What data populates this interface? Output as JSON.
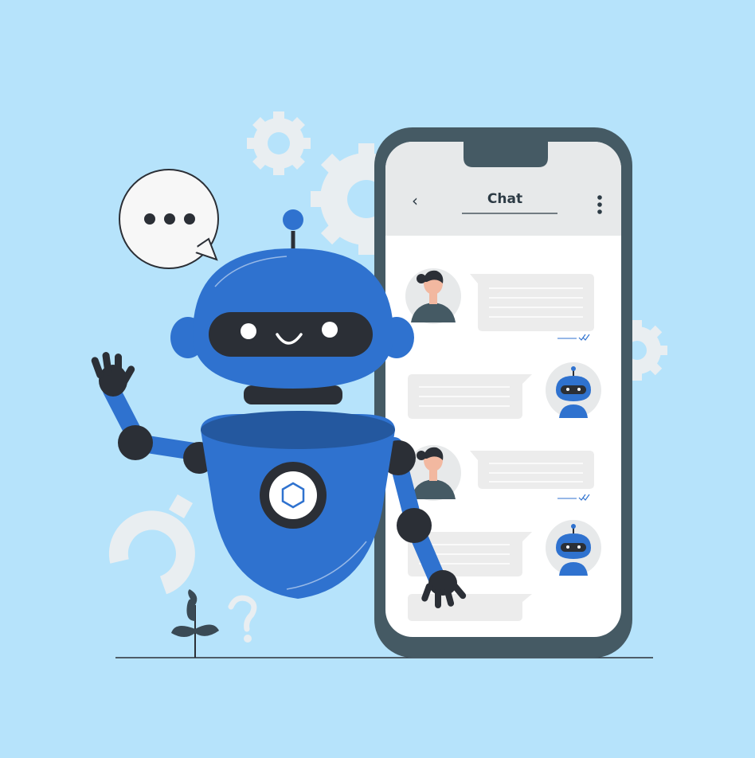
{
  "chat": {
    "title": "Chat",
    "back_icon": "chevron-left-icon",
    "menu_icon": "kebab-menu-icon"
  },
  "messages": [
    {
      "sender": "user",
      "avatar": "woman-avatar-icon",
      "status": "double-check-icon"
    },
    {
      "sender": "bot",
      "avatar": "robot-avatar-icon"
    },
    {
      "sender": "user",
      "avatar": "woman-avatar-icon",
      "status": "double-check-icon"
    },
    {
      "sender": "bot",
      "avatar": "robot-avatar-icon"
    }
  ],
  "decorations": [
    "speech-bubble-icon",
    "gear-icon",
    "question-mark-icon",
    "plant-icon"
  ],
  "colors": {
    "background": "#b6e3fb",
    "robot_blue": "#2f72cf",
    "dark": "#2b2f36",
    "phone_frame": "#455a64",
    "bubble": "#ececec"
  }
}
